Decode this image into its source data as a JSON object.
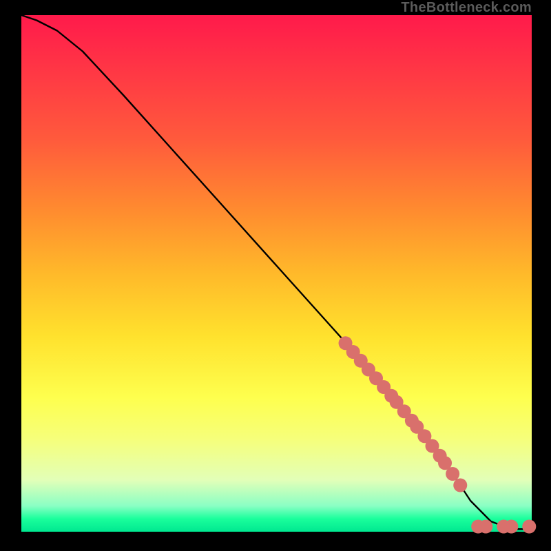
{
  "attribution": "TheBottleneck.com",
  "colors": {
    "marker": "#d9706c",
    "curve": "#000000"
  },
  "chart_data": {
    "type": "line",
    "title": "",
    "xlabel": "",
    "ylabel": "",
    "xlim": [
      0,
      100
    ],
    "ylim": [
      0,
      100
    ],
    "grid": false,
    "series": [
      {
        "name": "curve",
        "x": [
          0,
          3,
          7,
          12,
          20,
          30,
          40,
          50,
          60,
          70,
          78,
          84,
          88,
          92,
          96,
          100
        ],
        "y": [
          100,
          99,
          97,
          93,
          84.5,
          73.5,
          62.5,
          51.5,
          40.5,
          29.5,
          20,
          12,
          6,
          2,
          0.5,
          0.5
        ]
      }
    ],
    "markers": {
      "name": "highlighted-points",
      "points": [
        {
          "x": 63.5,
          "y": 36.5
        },
        {
          "x": 65.0,
          "y": 34.8
        },
        {
          "x": 66.5,
          "y": 33.1
        },
        {
          "x": 68.0,
          "y": 31.4
        },
        {
          "x": 69.5,
          "y": 29.7
        },
        {
          "x": 71.0,
          "y": 28.0
        },
        {
          "x": 72.5,
          "y": 26.3
        },
        {
          "x": 73.5,
          "y": 25.1
        },
        {
          "x": 75.0,
          "y": 23.3
        },
        {
          "x": 76.5,
          "y": 21.5
        },
        {
          "x": 77.5,
          "y": 20.3
        },
        {
          "x": 79.0,
          "y": 18.5
        },
        {
          "x": 80.5,
          "y": 16.6
        },
        {
          "x": 82.0,
          "y": 14.7
        },
        {
          "x": 83.0,
          "y": 13.3
        },
        {
          "x": 84.5,
          "y": 11.2
        },
        {
          "x": 86.0,
          "y": 9.0
        },
        {
          "x": 89.5,
          "y": 1.0
        },
        {
          "x": 91.0,
          "y": 1.0
        },
        {
          "x": 94.5,
          "y": 1.0
        },
        {
          "x": 96.0,
          "y": 1.0
        },
        {
          "x": 99.5,
          "y": 1.0
        }
      ]
    }
  }
}
